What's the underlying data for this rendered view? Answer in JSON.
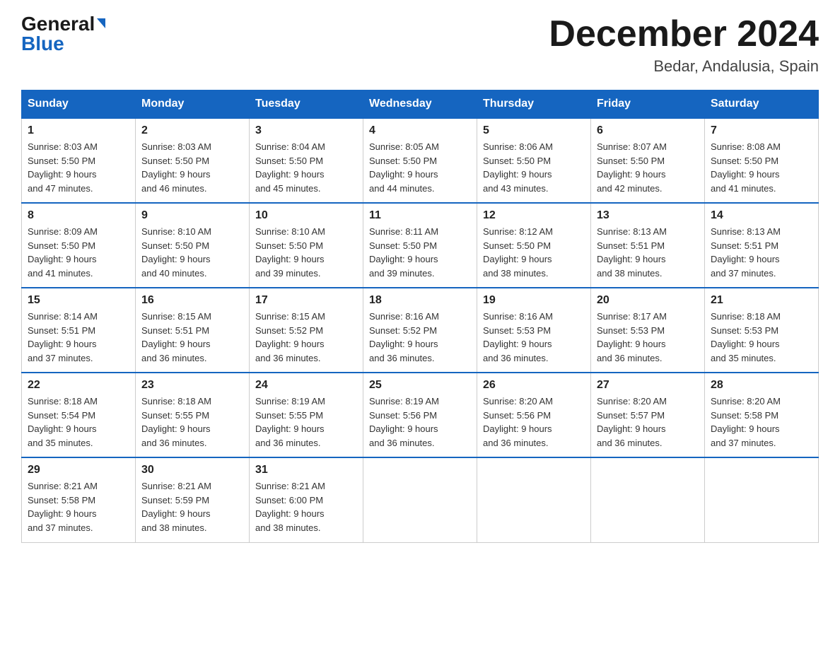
{
  "logo": {
    "part1": "General",
    "part2": "Blue"
  },
  "title": "December 2024",
  "subtitle": "Bedar, Andalusia, Spain",
  "days_header": [
    "Sunday",
    "Monday",
    "Tuesday",
    "Wednesday",
    "Thursday",
    "Friday",
    "Saturday"
  ],
  "weeks": [
    [
      {
        "day": "1",
        "sunrise": "8:03 AM",
        "sunset": "5:50 PM",
        "daylight": "9 hours and 47 minutes."
      },
      {
        "day": "2",
        "sunrise": "8:03 AM",
        "sunset": "5:50 PM",
        "daylight": "9 hours and 46 minutes."
      },
      {
        "day": "3",
        "sunrise": "8:04 AM",
        "sunset": "5:50 PM",
        "daylight": "9 hours and 45 minutes."
      },
      {
        "day": "4",
        "sunrise": "8:05 AM",
        "sunset": "5:50 PM",
        "daylight": "9 hours and 44 minutes."
      },
      {
        "day": "5",
        "sunrise": "8:06 AM",
        "sunset": "5:50 PM",
        "daylight": "9 hours and 43 minutes."
      },
      {
        "day": "6",
        "sunrise": "8:07 AM",
        "sunset": "5:50 PM",
        "daylight": "9 hours and 42 minutes."
      },
      {
        "day": "7",
        "sunrise": "8:08 AM",
        "sunset": "5:50 PM",
        "daylight": "9 hours and 41 minutes."
      }
    ],
    [
      {
        "day": "8",
        "sunrise": "8:09 AM",
        "sunset": "5:50 PM",
        "daylight": "9 hours and 41 minutes."
      },
      {
        "day": "9",
        "sunrise": "8:10 AM",
        "sunset": "5:50 PM",
        "daylight": "9 hours and 40 minutes."
      },
      {
        "day": "10",
        "sunrise": "8:10 AM",
        "sunset": "5:50 PM",
        "daylight": "9 hours and 39 minutes."
      },
      {
        "day": "11",
        "sunrise": "8:11 AM",
        "sunset": "5:50 PM",
        "daylight": "9 hours and 39 minutes."
      },
      {
        "day": "12",
        "sunrise": "8:12 AM",
        "sunset": "5:50 PM",
        "daylight": "9 hours and 38 minutes."
      },
      {
        "day": "13",
        "sunrise": "8:13 AM",
        "sunset": "5:51 PM",
        "daylight": "9 hours and 38 minutes."
      },
      {
        "day": "14",
        "sunrise": "8:13 AM",
        "sunset": "5:51 PM",
        "daylight": "9 hours and 37 minutes."
      }
    ],
    [
      {
        "day": "15",
        "sunrise": "8:14 AM",
        "sunset": "5:51 PM",
        "daylight": "9 hours and 37 minutes."
      },
      {
        "day": "16",
        "sunrise": "8:15 AM",
        "sunset": "5:51 PM",
        "daylight": "9 hours and 36 minutes."
      },
      {
        "day": "17",
        "sunrise": "8:15 AM",
        "sunset": "5:52 PM",
        "daylight": "9 hours and 36 minutes."
      },
      {
        "day": "18",
        "sunrise": "8:16 AM",
        "sunset": "5:52 PM",
        "daylight": "9 hours and 36 minutes."
      },
      {
        "day": "19",
        "sunrise": "8:16 AM",
        "sunset": "5:53 PM",
        "daylight": "9 hours and 36 minutes."
      },
      {
        "day": "20",
        "sunrise": "8:17 AM",
        "sunset": "5:53 PM",
        "daylight": "9 hours and 36 minutes."
      },
      {
        "day": "21",
        "sunrise": "8:18 AM",
        "sunset": "5:53 PM",
        "daylight": "9 hours and 35 minutes."
      }
    ],
    [
      {
        "day": "22",
        "sunrise": "8:18 AM",
        "sunset": "5:54 PM",
        "daylight": "9 hours and 35 minutes."
      },
      {
        "day": "23",
        "sunrise": "8:18 AM",
        "sunset": "5:55 PM",
        "daylight": "9 hours and 36 minutes."
      },
      {
        "day": "24",
        "sunrise": "8:19 AM",
        "sunset": "5:55 PM",
        "daylight": "9 hours and 36 minutes."
      },
      {
        "day": "25",
        "sunrise": "8:19 AM",
        "sunset": "5:56 PM",
        "daylight": "9 hours and 36 minutes."
      },
      {
        "day": "26",
        "sunrise": "8:20 AM",
        "sunset": "5:56 PM",
        "daylight": "9 hours and 36 minutes."
      },
      {
        "day": "27",
        "sunrise": "8:20 AM",
        "sunset": "5:57 PM",
        "daylight": "9 hours and 36 minutes."
      },
      {
        "day": "28",
        "sunrise": "8:20 AM",
        "sunset": "5:58 PM",
        "daylight": "9 hours and 37 minutes."
      }
    ],
    [
      {
        "day": "29",
        "sunrise": "8:21 AM",
        "sunset": "5:58 PM",
        "daylight": "9 hours and 37 minutes."
      },
      {
        "day": "30",
        "sunrise": "8:21 AM",
        "sunset": "5:59 PM",
        "daylight": "9 hours and 38 minutes."
      },
      {
        "day": "31",
        "sunrise": "8:21 AM",
        "sunset": "6:00 PM",
        "daylight": "9 hours and 38 minutes."
      },
      null,
      null,
      null,
      null
    ]
  ],
  "labels": {
    "sunrise": "Sunrise:",
    "sunset": "Sunset:",
    "daylight": "Daylight:"
  }
}
